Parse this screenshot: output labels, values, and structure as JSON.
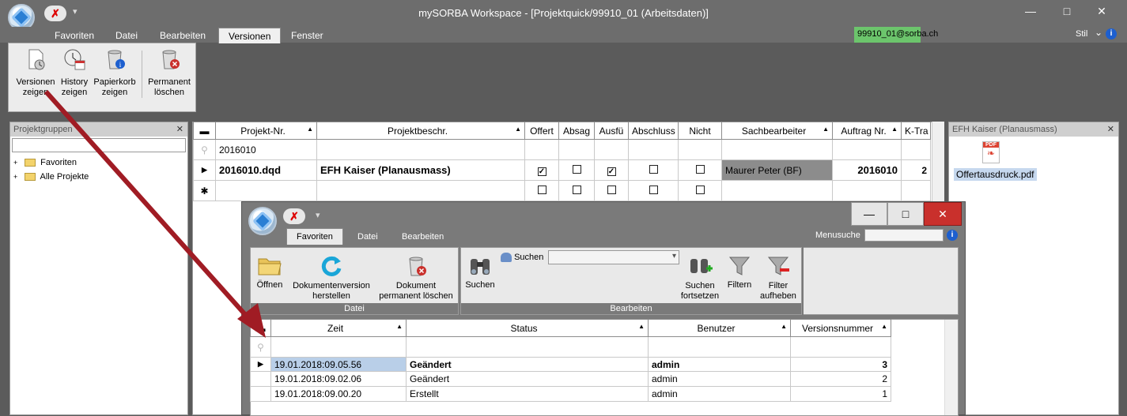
{
  "app": {
    "title": "mySORBA Workspace - [Projektquick/99910_01 (Arbeitsdaten)]",
    "qa_close": "✗",
    "qa_dropdown": "▾",
    "minimize": "—",
    "maximize": "□",
    "close": "✕"
  },
  "menu": {
    "tabs": [
      "Favoriten",
      "Datei",
      "Bearbeiten",
      "Versionen",
      "Fenster"
    ],
    "active_tab": "Versionen",
    "user_email": "99910_01@sorba.ch",
    "stil_label": "Stil",
    "stil_arrow": "⌄",
    "info": "i"
  },
  "ribbon": {
    "buttons": [
      {
        "label1": "Versionen",
        "label2": "zeigen"
      },
      {
        "label1": "History",
        "label2": "zeigen"
      },
      {
        "label1": "Papierkorb",
        "label2": "zeigen"
      },
      {
        "label1": "Permanent",
        "label2": "löschen"
      }
    ]
  },
  "left_panel": {
    "title": "Projektgruppen",
    "close": "✕",
    "expander": "+",
    "items": [
      "Favoriten",
      "Alle Projekte"
    ]
  },
  "main_grid": {
    "columns": [
      "Projekt-Nr.",
      "Projektbeschr.",
      "Offert",
      "Absag",
      "Ausfü",
      "Abschluss",
      "Nicht",
      "Sachbearbeiter",
      "Auftrag Nr.",
      "K-Tra"
    ],
    "header_marker": "▬",
    "sort_up": "▲",
    "filter_icon": "⚲",
    "row_indicator": "▶",
    "new_row_marker": "✱",
    "check": "✓",
    "filter_row": {
      "projekt_nr": "2016010"
    },
    "rows": [
      {
        "projekt_nr": "2016010.dqd",
        "beschr": "EFH Kaiser (Planausmass)",
        "offert": true,
        "absag": false,
        "ausfu": true,
        "abschluss": false,
        "nicht": false,
        "sachbearbeiter": "Maurer Peter (BF)",
        "auftrag": "2016010",
        "ktra": "2"
      }
    ]
  },
  "right_panel": {
    "title": "EFH Kaiser (Planausmass)",
    "close": "✕",
    "pdf_badge": "PDF",
    "file": "Offertausdruck.pdf"
  },
  "inner_window": {
    "qa_close": "✗",
    "qa_dropdown": "▾",
    "minimize": "—",
    "maximize": "□",
    "close": "✕",
    "tabs": [
      "Favoriten",
      "Datei",
      "Bearbeiten"
    ],
    "active_tab": "Favoriten",
    "menusuche_label": "Menusuche",
    "info": "i",
    "datei_group": {
      "label": "Datei",
      "buttons": [
        {
          "label1": "Öffnen",
          "label2": ""
        },
        {
          "label1": "Dokumentenversion",
          "label2": "herstellen"
        },
        {
          "label1": "Dokument",
          "label2": "permanent löschen"
        }
      ]
    },
    "bearbeiten_group": {
      "label": "Bearbeiten",
      "suchen_label": "Suchen",
      "dropdown_arrow": "▾",
      "buttons": [
        {
          "label1": "Suchen",
          "label2": ""
        },
        {
          "label1": "Suchen",
          "label2": "fortsetzen"
        },
        {
          "label1": "Filtern",
          "label2": ""
        },
        {
          "label1": "Filter",
          "label2": "aufheben"
        }
      ]
    },
    "grid": {
      "columns": [
        "Zeit",
        "Status",
        "Benutzer",
        "Versionsnummer"
      ],
      "rows": [
        {
          "zeit": "19.01.2018:09.05.56",
          "status": "Geändert",
          "benutzer": "admin",
          "nr": "3"
        },
        {
          "zeit": "19.01.2018:09.02.06",
          "status": "Geändert",
          "benutzer": "admin",
          "nr": "2"
        },
        {
          "zeit": "19.01.2018:09.00.20",
          "status": "Erstellt",
          "benutzer": "admin",
          "nr": "1"
        }
      ]
    }
  },
  "colors": {
    "arrow": "#a01c24",
    "email_bg": "#6cc56c",
    "close_red": "#c9302c"
  }
}
